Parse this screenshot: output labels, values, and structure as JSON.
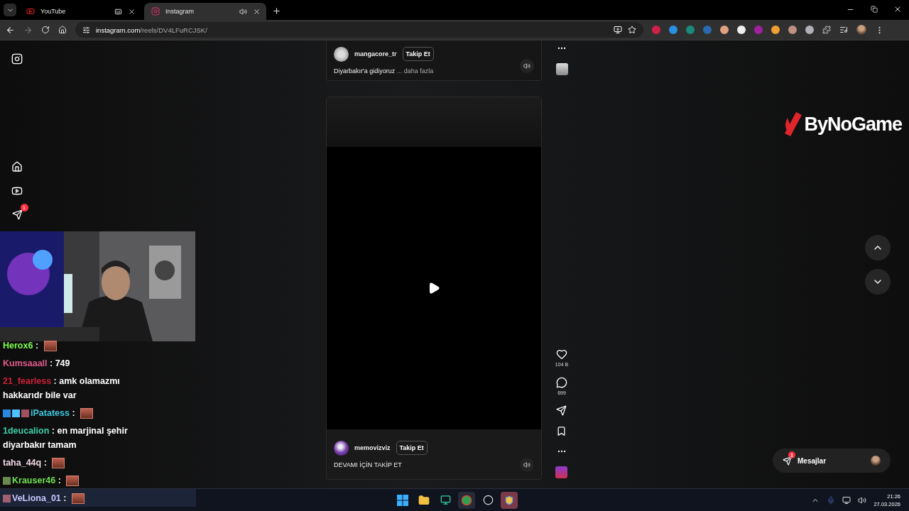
{
  "browser": {
    "tabs": [
      {
        "title": "YouTube",
        "kind": "youtube",
        "selected": false
      },
      {
        "title": "Instagram",
        "kind": "instagram",
        "selected": true
      }
    ],
    "forward_disabled": true,
    "url": {
      "host": "instagram.com",
      "path": "/reels/DV4LFuRCJSK/"
    }
  },
  "instagram": {
    "nav_badge": "1",
    "reels": [
      {
        "username": "mangacore_tr",
        "follow": "Takip Et",
        "caption": "Diyarbakır'a gidiyoruz",
        "more": "... daha fazla"
      },
      {
        "username": "memovizviz",
        "follow": "Takip Et",
        "caption": "DEVAMI İÇİN TAKİP ET"
      }
    ],
    "likes": "104 B",
    "comments": "699",
    "messages": {
      "label": "Mesajlar",
      "badge": "1"
    }
  },
  "overlay": {
    "logo": "ByNoGame",
    "chat": [
      {
        "author": "Herox6",
        "color": "#7dff4f",
        "sep": ":",
        "kind": "emote"
      },
      {
        "author": "Kumsaaall",
        "color": "#e05a8a",
        "sep": ":",
        "kind": "text",
        "text": "749"
      },
      {
        "author": "21_fearless",
        "color": "#d0203a",
        "sep": ":",
        "kind": "text",
        "lines": [
          "amk olamazmı",
          "hakkarıdr bile var"
        ]
      },
      {
        "author": "iPatatess",
        "color": "#3fc8e0",
        "sep": ":",
        "kind": "emote",
        "badges": [
          {
            "color": "#2a8ae0"
          },
          {
            "color": "#4fc0ff"
          },
          {
            "color": "#a05060"
          }
        ]
      },
      {
        "author": "1deucalion",
        "color": "#3fd0a8",
        "sep": ":",
        "kind": "text",
        "lines": [
          "en marjinal şehir",
          "diyarbakır tamam"
        ]
      },
      {
        "author": "taha_44q",
        "color": "#f0d8e6",
        "sep": ":",
        "kind": "emote"
      },
      {
        "author": "Krauser46",
        "color": "#6fe050",
        "sep": ":",
        "kind": "emote",
        "badges": [
          {
            "color": "#6a8a50"
          }
        ]
      },
      {
        "author": "VeLiona_01",
        "color": "#c8c8ff",
        "sep": ":",
        "kind": "emote",
        "badges": [
          {
            "color": "#a06070"
          }
        ]
      }
    ]
  },
  "taskbar": {
    "time": "21:26",
    "date": "27.03.2026"
  }
}
